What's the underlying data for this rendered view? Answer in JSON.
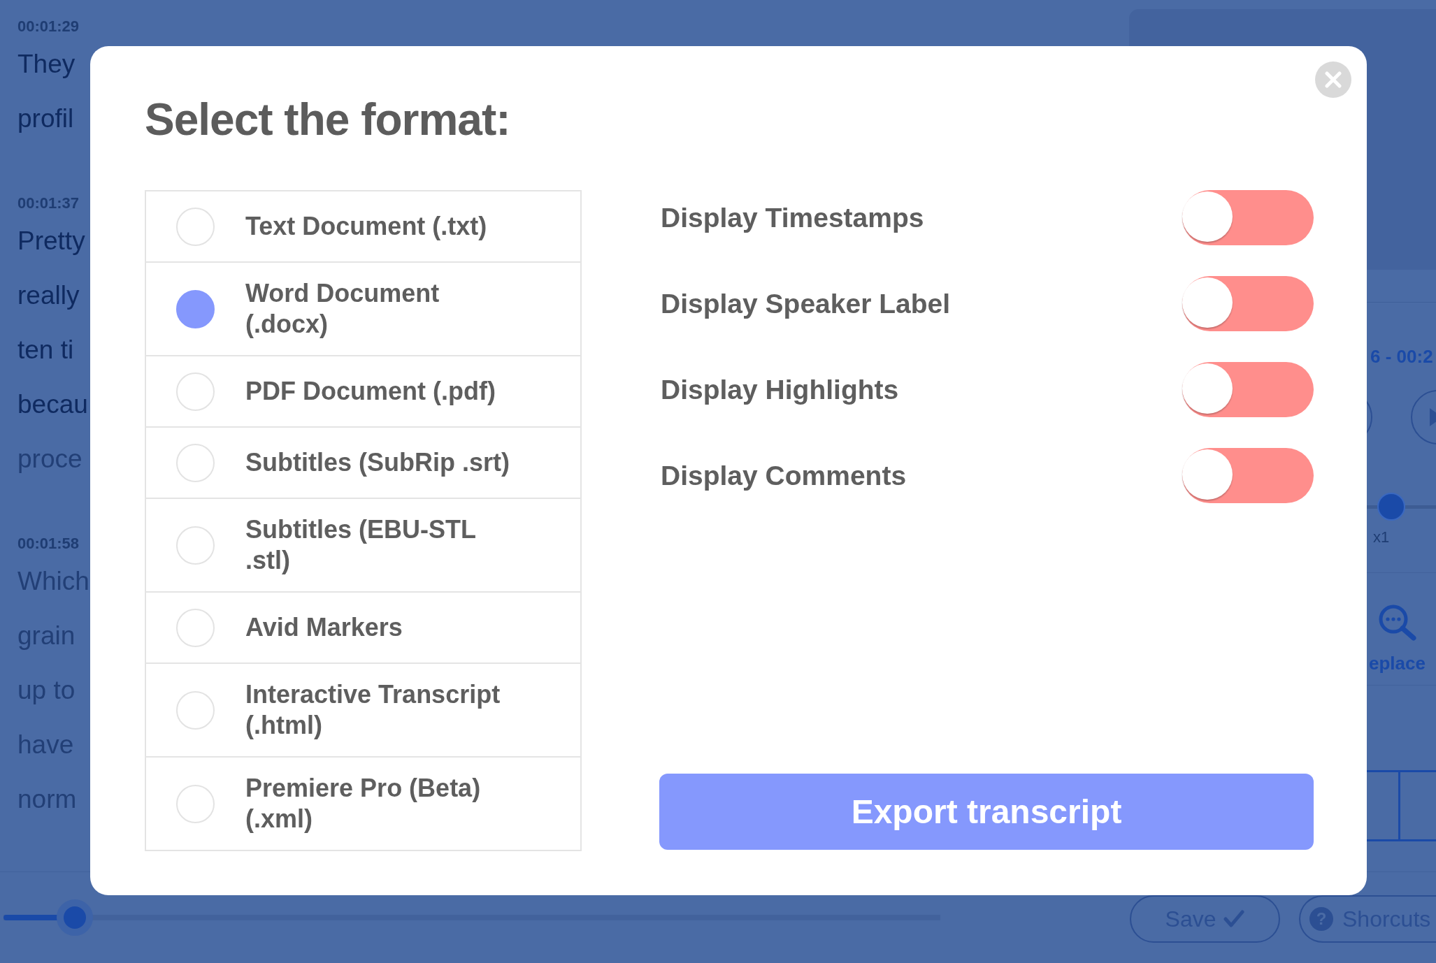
{
  "transcript": [
    {
      "time": "00:01:29",
      "lines": [
        {
          "text": "They",
          "spoken": true
        },
        {
          "text": "profil",
          "spoken": true
        }
      ]
    },
    {
      "time": "00:01:37",
      "lines": [
        {
          "text": "Pretty",
          "spoken": true
        },
        {
          "text": "really",
          "spoken": true
        },
        {
          "text": "ten ti",
          "spoken": true
        },
        {
          "text": "becau",
          "spoken": true
        },
        {
          "text": "proce",
          "spoken": false
        }
      ]
    },
    {
      "time": "00:01:58",
      "lines": [
        {
          "text": "Which",
          "spoken": false
        },
        {
          "text": "grain",
          "spoken": false
        },
        {
          "text": "up to",
          "spoken": false
        },
        {
          "text": "have",
          "spoken": false
        },
        {
          "text": "norm",
          "spoken": false
        }
      ]
    }
  ],
  "player": {
    "time_range": "6 - 00:2",
    "speed": {
      "level": 0.35,
      "reading": "x1"
    },
    "tool_label": "eplace"
  },
  "progress": {
    "level": 0.076
  },
  "footer_buttons": [
    {
      "kind": "save",
      "label": "Save"
    },
    {
      "kind": "help",
      "icon": "?",
      "label": "Shorcuts"
    }
  ],
  "dialog": {
    "title": "Select the format:",
    "formats": [
      {
        "label": "Text Document (.txt)",
        "selected": false
      },
      {
        "label": "Word Document (.docx)",
        "selected": true
      },
      {
        "label": "PDF Document (.pdf)",
        "selected": false
      },
      {
        "label": "Subtitles (SubRip .srt)",
        "selected": false
      },
      {
        "label": "Subtitles (EBU-STL .stl)",
        "selected": false
      },
      {
        "label": "Avid Markers",
        "selected": false
      },
      {
        "label": "Interactive Transcript (.html)",
        "selected": false
      },
      {
        "label": "Premiere Pro (Beta) (.xml)",
        "selected": false
      }
    ],
    "options": [
      {
        "label": "Display Timestamps",
        "on": false
      },
      {
        "label": "Display Speaker Label",
        "on": false
      },
      {
        "label": "Display Highlights",
        "on": false
      },
      {
        "label": "Display Comments",
        "on": false
      }
    ],
    "export_button": "Export transcript"
  }
}
